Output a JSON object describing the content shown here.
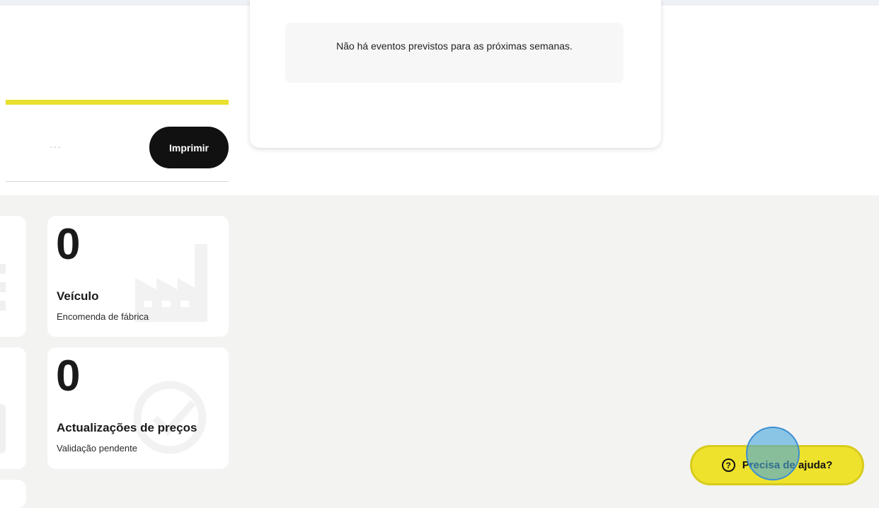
{
  "toolbar": {
    "more_label": "···",
    "print_label": "Imprimir"
  },
  "events": {
    "empty_message": "Não há eventos previstos para as próximas semanas."
  },
  "stats": [
    {
      "value": "0",
      "title": "Veículo",
      "subtitle": "Encomenda de fábrica",
      "icon": "factory-icon"
    },
    {
      "value": "0",
      "title": "Actualizações de preços",
      "subtitle": "Validação pendente",
      "icon": "check-circle-icon"
    }
  ],
  "help": {
    "label": "Precisa de ajuda?",
    "icon_glyph": "?",
    "accent": "#eee22c"
  }
}
